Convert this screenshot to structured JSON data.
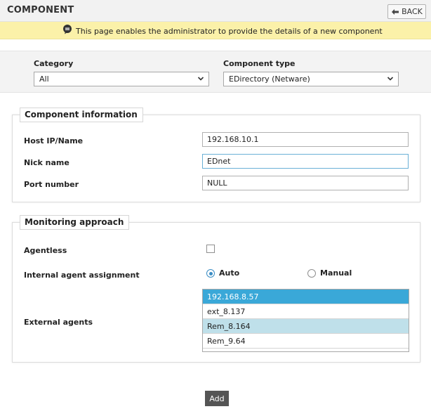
{
  "header": {
    "title": "COMPONENT",
    "back_label": "BACK"
  },
  "info": {
    "message": "This page enables the administrator to provide the details of a new component"
  },
  "filters": {
    "category": {
      "label": "Category",
      "value": "All"
    },
    "component_type": {
      "label": "Component type",
      "value": "EDirectory (Netware)"
    }
  },
  "component_info": {
    "legend": "Component information",
    "host": {
      "label": "Host IP/Name",
      "value": "192.168.10.1"
    },
    "nick": {
      "label": "Nick name",
      "value": "EDnet"
    },
    "port": {
      "label": "Port number",
      "value": "NULL"
    }
  },
  "monitoring": {
    "legend": "Monitoring approach",
    "agentless": {
      "label": "Agentless",
      "checked": false
    },
    "internal_agent": {
      "label": "Internal agent assignment",
      "auto_label": "Auto",
      "manual_label": "Manual",
      "selected": "Auto"
    },
    "external_agents": {
      "label": "External agents",
      "items": [
        "192.168.8.57",
        "ext_8.137",
        "Rem_8.164",
        "Rem_9.64"
      ]
    }
  },
  "actions": {
    "add_label": "Add"
  },
  "colors": {
    "info_bg": "#fbf1a9",
    "selection": "#3aa8d8",
    "hover": "#bfe0ea",
    "radio": "#3b8dc4",
    "add_button": "#555555"
  }
}
